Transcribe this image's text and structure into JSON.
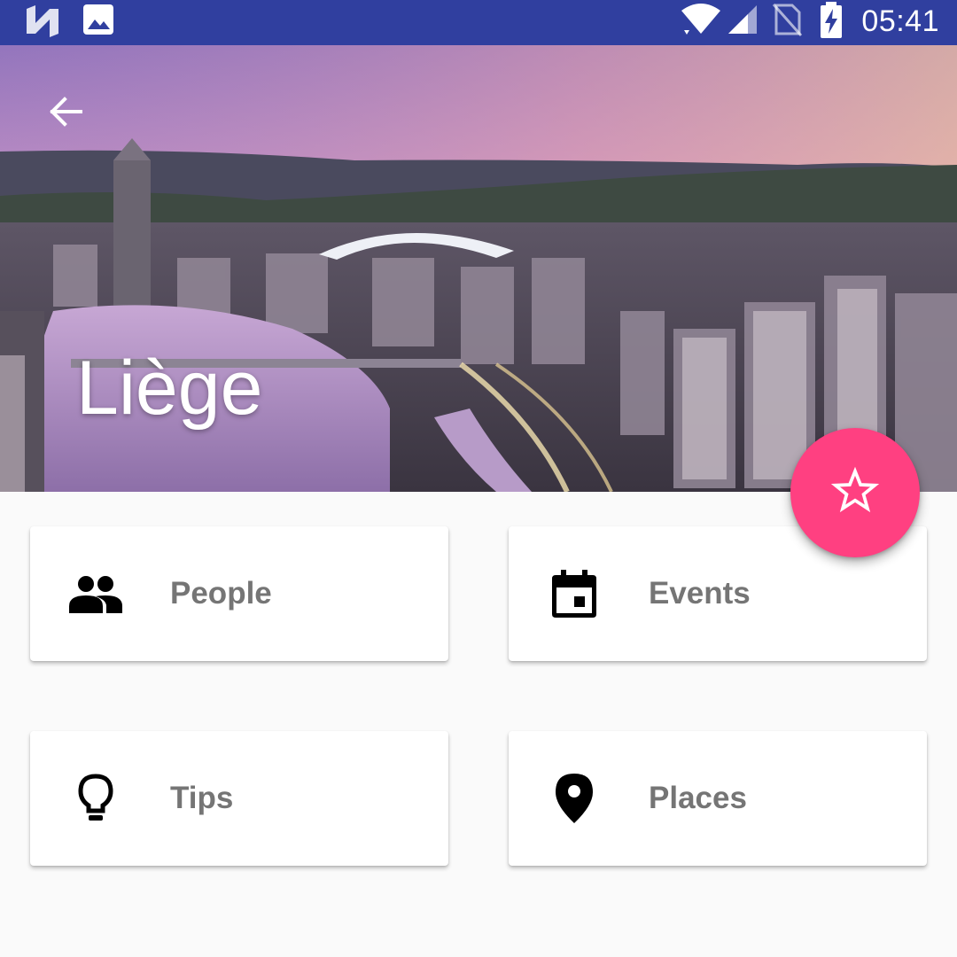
{
  "status_bar": {
    "time": "05:41",
    "left_icons": [
      "n-icon",
      "image-icon"
    ],
    "right_icons": [
      "wifi-icon",
      "signal-icon",
      "no-sim-icon",
      "battery-charging-icon"
    ],
    "background_color": "#303f9f"
  },
  "header": {
    "title": "Liège",
    "back_icon": "arrow-back-icon"
  },
  "fab": {
    "icon": "star-outline-icon",
    "color": "#ff4081"
  },
  "cards": [
    {
      "label": "People",
      "icon": "people-icon"
    },
    {
      "label": "Events",
      "icon": "calendar-event-icon"
    },
    {
      "label": "Tips",
      "icon": "lightbulb-icon"
    },
    {
      "label": "Places",
      "icon": "place-icon"
    }
  ]
}
